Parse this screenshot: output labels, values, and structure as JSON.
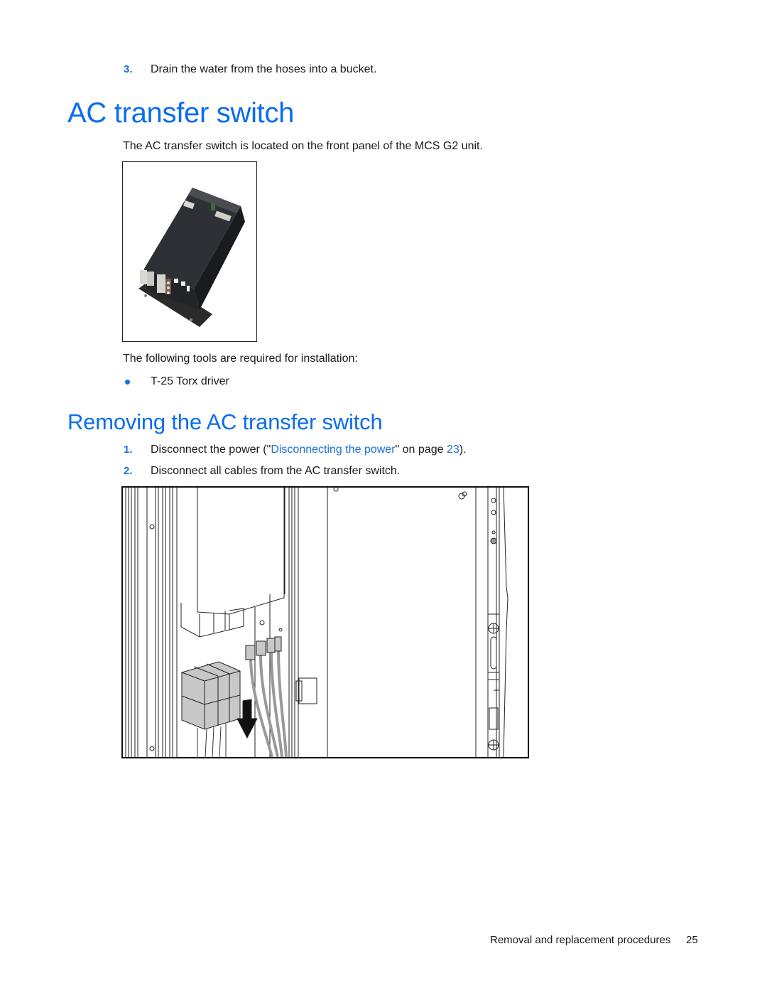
{
  "steps_top": [
    {
      "number": "3.",
      "text": "Drain the water from the hoses into a bucket."
    }
  ],
  "section1": {
    "title": "AC transfer switch",
    "intro": "The AC transfer switch is located on the front panel of the MCS G2 unit.",
    "figure_alt": "AC transfer switch unit photo",
    "tools_intro": "The following tools are required for installation:",
    "tools": [
      "T-25 Torx driver"
    ]
  },
  "section2": {
    "title": "Removing the AC transfer switch",
    "steps": [
      {
        "number": "1.",
        "text_before": "Disconnect the power (\"",
        "link_text": "Disconnecting the power",
        "text_mid": "\" on page ",
        "page_link": "23",
        "text_after": ")."
      },
      {
        "number": "2.",
        "text": "Disconnect all cables from the AC transfer switch."
      }
    ],
    "figure_alt": "Line drawing of cables being disconnected from AC transfer switch"
  },
  "footer": {
    "section_name": "Removal and replacement procedures",
    "page_number": "25"
  },
  "colors": {
    "heading": "#0a6cf0",
    "link": "#1a6fd9",
    "text": "#1a1a1a"
  }
}
